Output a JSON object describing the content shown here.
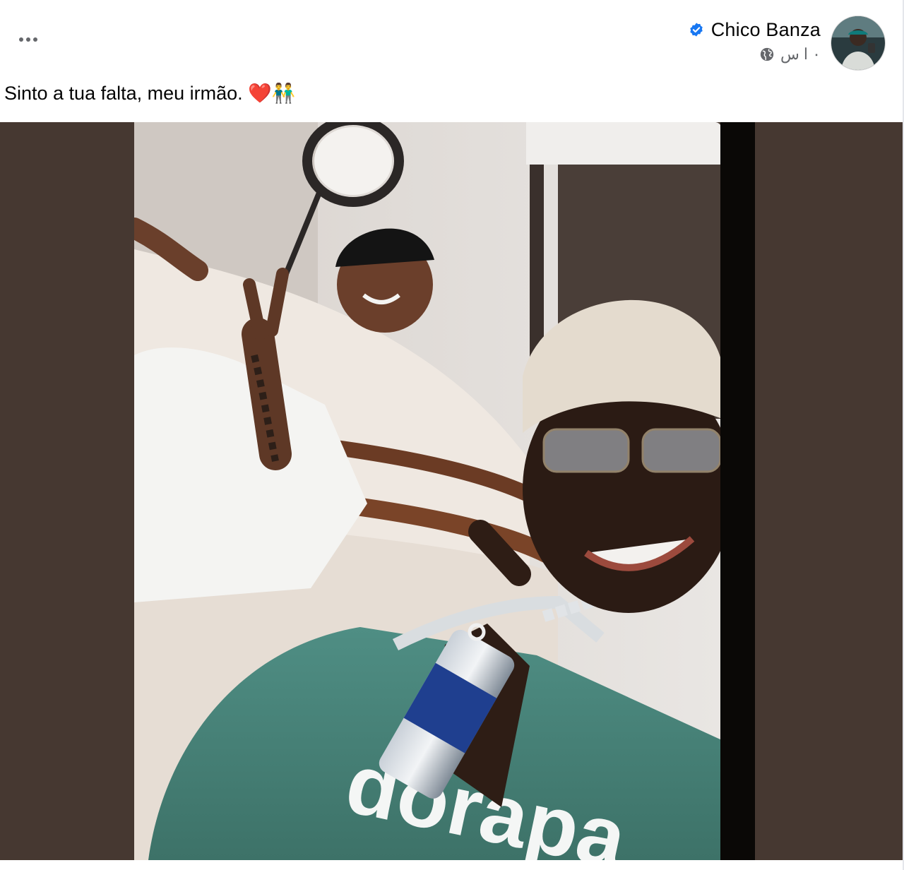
{
  "post": {
    "author": {
      "name": "Chico Banza",
      "verified": true,
      "avatar_icon": "user-avatar-photo"
    },
    "timestamp": "٠ ا س",
    "visibility_icon": "globe-icon",
    "more_icon": "more-options-icon",
    "caption": "Sinto a tua falta, meu irmão. ❤️👬",
    "media": {
      "type": "photo",
      "background": "#463831"
    }
  },
  "colors": {
    "verified_blue": "#1877f2",
    "text_primary": "#050505",
    "text_secondary": "#65676b"
  }
}
